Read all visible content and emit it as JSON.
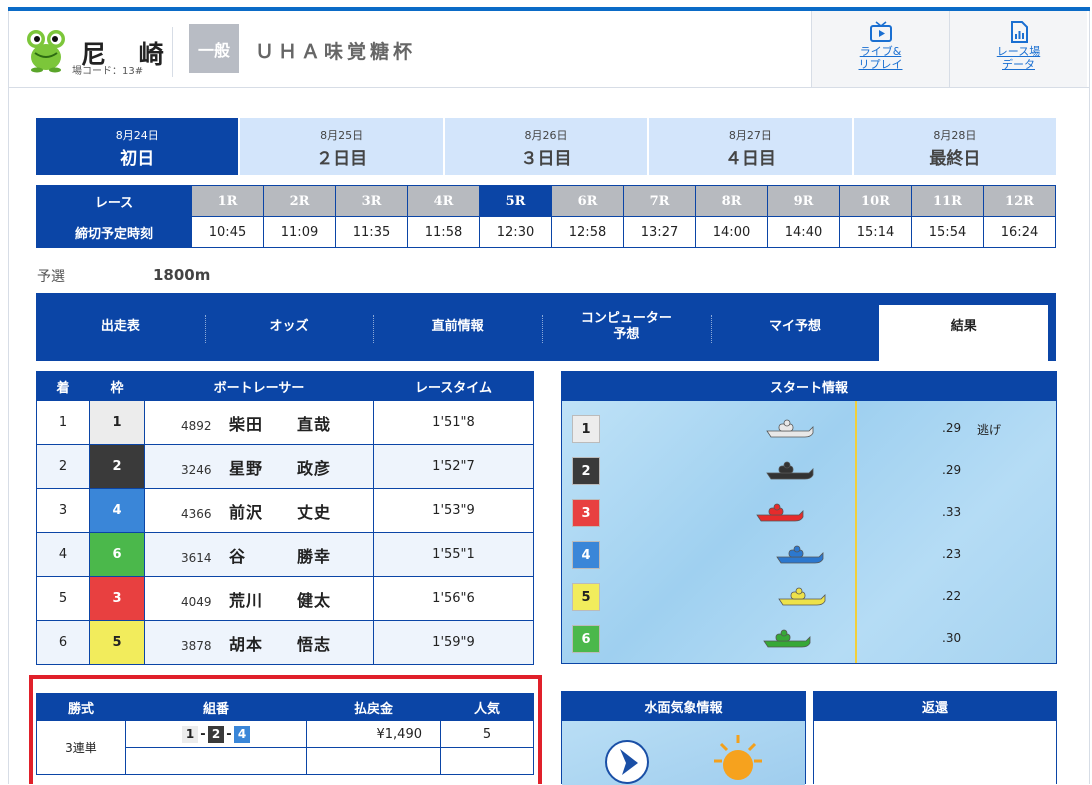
{
  "header": {
    "venue_name": "尼 崎",
    "venue_code": "場コード：13#",
    "grade": "一般",
    "race_title": "ＵＨＡ味覚糖杯",
    "buttons": [
      {
        "label": "ライブ&\nリプレイ",
        "icon": "tv-play-icon"
      },
      {
        "label": "レース場\nデータ",
        "icon": "data-document-icon"
      }
    ]
  },
  "days": [
    {
      "date": "8月24日",
      "name": "初日",
      "active": true
    },
    {
      "date": "8月25日",
      "name": "２日目",
      "active": false
    },
    {
      "date": "8月26日",
      "name": "３日目",
      "active": false
    },
    {
      "date": "8月27日",
      "name": "４日目",
      "active": false
    },
    {
      "date": "8月28日",
      "name": "最終日",
      "active": false
    }
  ],
  "races": {
    "row1_label": "レース",
    "row2_label": "締切予定時刻",
    "current": "5R",
    "list": [
      {
        "r": "1R",
        "t": "10:45"
      },
      {
        "r": "2R",
        "t": "11:09"
      },
      {
        "r": "3R",
        "t": "11:35"
      },
      {
        "r": "4R",
        "t": "11:58"
      },
      {
        "r": "5R",
        "t": "12:30"
      },
      {
        "r": "6R",
        "t": "12:58"
      },
      {
        "r": "7R",
        "t": "13:27"
      },
      {
        "r": "8R",
        "t": "14:00"
      },
      {
        "r": "9R",
        "t": "14:40"
      },
      {
        "r": "10R",
        "t": "15:14"
      },
      {
        "r": "11R",
        "t": "15:54"
      },
      {
        "r": "12R",
        "t": "16:24"
      }
    ]
  },
  "race_meta": {
    "type": "予選",
    "distance": "1800m"
  },
  "tabs": [
    {
      "label": "出走表",
      "active": false
    },
    {
      "label": "オッズ",
      "active": false
    },
    {
      "label": "直前情報",
      "active": false
    },
    {
      "label": "コンピューター\n予想",
      "active": false
    },
    {
      "label": "マイ予想",
      "active": false
    },
    {
      "label": "結果",
      "active": true
    }
  ],
  "results": {
    "headers": [
      "着",
      "枠",
      "ボートレーサー",
      "レースタイム"
    ],
    "rows": [
      {
        "place": "1",
        "frame": "1",
        "number": "4892",
        "name": "柴田　　直哉",
        "time": "1'51\"8"
      },
      {
        "place": "2",
        "frame": "2",
        "number": "3246",
        "name": "星野　　政彦",
        "time": "1'52\"7"
      },
      {
        "place": "3",
        "frame": "4",
        "number": "4366",
        "name": "前沢　　丈史",
        "time": "1'53\"9"
      },
      {
        "place": "4",
        "frame": "6",
        "number": "3614",
        "name": "谷　　　勝幸",
        "time": "1'55\"1"
      },
      {
        "place": "5",
        "frame": "3",
        "number": "4049",
        "name": "荒川　　健太",
        "time": "1'56\"6"
      },
      {
        "place": "6",
        "frame": "5",
        "number": "3878",
        "name": "胡本　　悟志",
        "time": "1'59\"9"
      }
    ]
  },
  "frame_colors": {
    "1": {
      "bg": "#ececec",
      "fg": "#222"
    },
    "2": {
      "bg": "#3a3a3a",
      "fg": "#fff"
    },
    "3": {
      "bg": "#e84040",
      "fg": "#fff"
    },
    "4": {
      "bg": "#3a86d8",
      "fg": "#fff"
    },
    "5": {
      "bg": "#f2ec5c",
      "fg": "#222"
    },
    "6": {
      "bg": "#4bb84b",
      "fg": "#fff"
    }
  },
  "start_info": {
    "title": "スタート情報",
    "rows": [
      {
        "lane": "1",
        "st": ".29",
        "kimarite": "逃げ",
        "boat_color": "#e8e8e8"
      },
      {
        "lane": "2",
        "st": ".29",
        "kimarite": "",
        "boat_color": "#333333"
      },
      {
        "lane": "3",
        "st": ".33",
        "kimarite": "",
        "boat_color": "#e62b2b"
      },
      {
        "lane": "4",
        "st": ".23",
        "kimarite": "",
        "boat_color": "#2c78cf"
      },
      {
        "lane": "5",
        "st": ".22",
        "kimarite": "",
        "boat_color": "#ede24a"
      },
      {
        "lane": "6",
        "st": ".30",
        "kimarite": "",
        "boat_color": "#37a837"
      }
    ]
  },
  "payout": {
    "headers": [
      "勝式",
      "組番",
      "払戻金",
      "人気"
    ],
    "rows": [
      {
        "type": "3連単",
        "combo": [
          "1",
          "2",
          "4"
        ],
        "amount": "¥1,490",
        "popularity": "5"
      }
    ]
  },
  "weather": {
    "title": "水面気象情報"
  },
  "refund": {
    "title": "返還"
  }
}
